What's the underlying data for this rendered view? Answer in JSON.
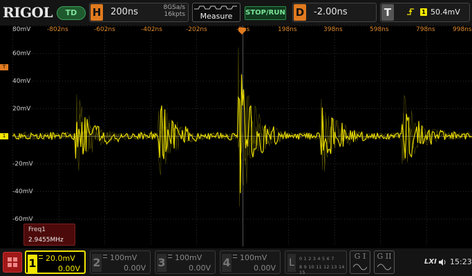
{
  "brand": "RIGOL",
  "mode_badge": "TD",
  "horizontal": {
    "letter": "H",
    "timebase": "200ns",
    "sample_rate": "8GSa/s",
    "memory_depth": "16kpts"
  },
  "measure_label": "Measure",
  "run_state": "STOP/RUN",
  "delay": {
    "letter": "D",
    "value": "-2.00ns"
  },
  "trigger": {
    "letter": "T",
    "source": "1",
    "level": "50.4mV"
  },
  "x_ticks": [
    "-802ns",
    "-602ns",
    "-402ns",
    "-202ns",
    "-2ns",
    "198ns",
    "398ns",
    "598ns",
    "798ns",
    "998ns"
  ],
  "y_ticks": [
    "80mV",
    "60mV",
    "40mV",
    "20mV",
    "-20mV",
    "-40mV",
    "-60mV"
  ],
  "markers": {
    "trigger_level": "T",
    "channel_ground": "1"
  },
  "measurement": {
    "name": "Freq1",
    "value": "2.9455MHz"
  },
  "channels": [
    {
      "num": "1",
      "scale": "20.0mV",
      "offset": "0.00V",
      "active": true
    },
    {
      "num": "2",
      "scale": "100mV",
      "offset": "0.00V",
      "active": false
    },
    {
      "num": "3",
      "scale": "100mV",
      "offset": "0.00V",
      "active": false
    },
    {
      "num": "4",
      "scale": "100mV",
      "offset": "0.00V",
      "active": false
    }
  ],
  "logic": {
    "letter": "L",
    "row1": "0 1 2 3 4 5 6 7",
    "row2": "8 9 10 11 12 13 14 15"
  },
  "generators": [
    "G I",
    "G II"
  ],
  "lxi": "LXI",
  "time": "15:23",
  "colors": {
    "ch1": "#f3e600",
    "accent": "#e07a1f",
    "grid": "#3a3a3a"
  }
}
